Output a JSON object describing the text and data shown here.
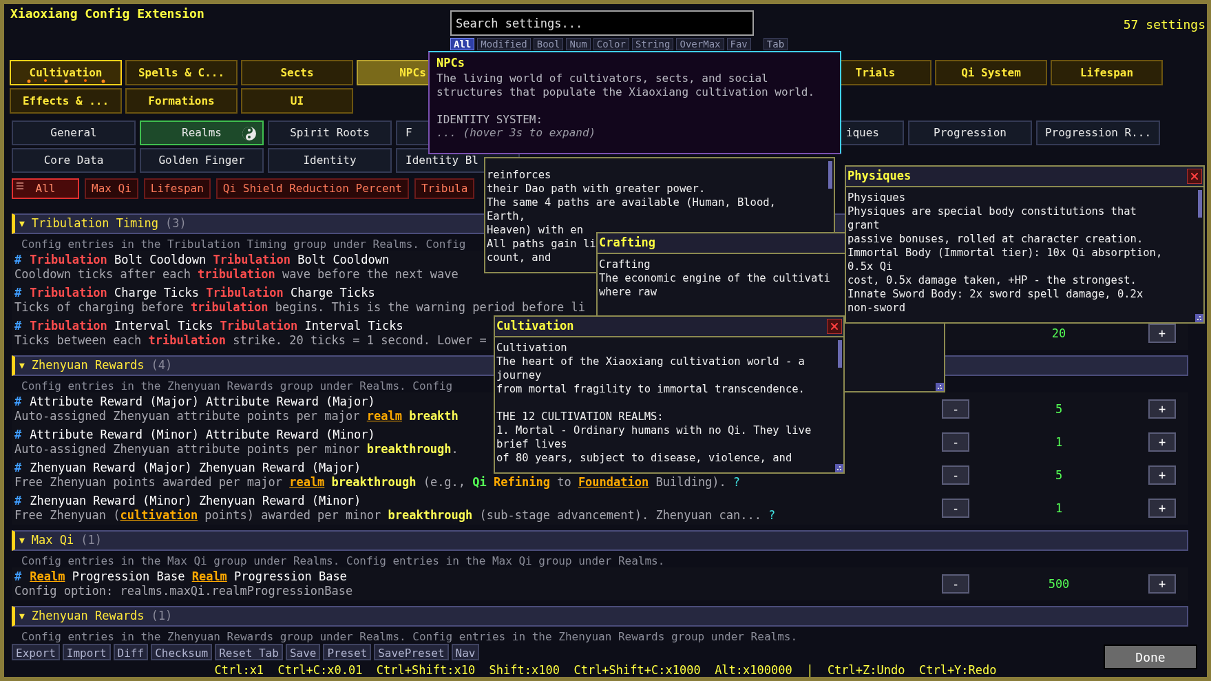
{
  "window": {
    "title": "Xiaoxiang Config Extension",
    "count": "57 settings"
  },
  "search": {
    "placeholder": "Search settings..."
  },
  "type_filters": [
    {
      "label": "All",
      "selected": true
    },
    {
      "label": "Modified",
      "selected": false
    },
    {
      "label": "Bool",
      "selected": false
    },
    {
      "label": "Num",
      "selected": false
    },
    {
      "label": "Color",
      "selected": false
    },
    {
      "label": "String",
      "selected": false
    },
    {
      "label": "OverMax",
      "selected": false
    },
    {
      "label": "Fav",
      "selected": false
    }
  ],
  "tab_chip": "Tab",
  "category_tabs": {
    "row_1_left": [
      {
        "label": "Cultivation",
        "selected": true,
        "hovered": false
      },
      {
        "label": "Spells & C...",
        "selected": false,
        "hovered": false
      },
      {
        "label": "Sects",
        "selected": false,
        "hovered": false
      },
      {
        "label": "NPCs",
        "selected": false,
        "hovered": true
      }
    ],
    "row_1_right": [
      {
        "label": "Trials",
        "selected": false,
        "hovered": false
      },
      {
        "label": "Qi System",
        "selected": false,
        "hovered": false
      },
      {
        "label": "Lifespan",
        "selected": false,
        "hovered": false
      }
    ],
    "row_2": [
      {
        "label": "Effects & ...",
        "selected": false,
        "hovered": false
      },
      {
        "label": "Formations",
        "selected": false,
        "hovered": false
      },
      {
        "label": "UI",
        "selected": false,
        "hovered": false
      }
    ]
  },
  "sub_tabs": {
    "row_1_left": [
      {
        "label": "General",
        "selected": false,
        "kind": "full"
      },
      {
        "label": "Realms",
        "selected": true,
        "kind": "full"
      },
      {
        "label": "Spirit Roots",
        "selected": false,
        "kind": "full"
      },
      {
        "label": "F",
        "selected": false,
        "kind": "cut_right"
      }
    ],
    "row_1_right": [
      {
        "label": "iques",
        "selected": false,
        "kind": "cut_left"
      },
      {
        "label": "Progression",
        "selected": false,
        "kind": "full"
      },
      {
        "label": "Progression R...",
        "selected": false,
        "kind": "full"
      }
    ],
    "row_2": [
      {
        "label": "Core Data",
        "selected": false,
        "kind": "full"
      },
      {
        "label": "Golden Finger",
        "selected": false,
        "kind": "full"
      },
      {
        "label": "Identity",
        "selected": false,
        "kind": "full"
      },
      {
        "label": "Identity Bl",
        "selected": false,
        "kind": "cut_right"
      }
    ]
  },
  "group_filters": [
    {
      "label": "All",
      "selected": true
    },
    {
      "label": "Max Qi",
      "selected": false
    },
    {
      "label": "Lifespan",
      "selected": false
    },
    {
      "label": "Qi Shield Reduction Percent",
      "selected": false
    },
    {
      "label": "Tribula",
      "selected": false
    }
  ],
  "groups": [
    {
      "arrow": "▼",
      "name": "Tribulation Timing",
      "count": "(3)",
      "description": "Config entries in the Tribulation Timing group under Realms. Config",
      "entries": [
        {
          "mark": "#",
          "title": [
            {
              "text": "Tribulation",
              "kind": "danger"
            },
            {
              "text": " Bolt Cooldown ",
              "kind": "plain"
            },
            {
              "text": "Tribulation",
              "kind": "danger"
            },
            {
              "text": " Bolt Cooldown",
              "kind": "plain"
            }
          ],
          "description": [
            {
              "text": "Cooldown ticks after each ",
              "kind": "plain"
            },
            {
              "text": "tribulation",
              "kind": "danger"
            },
            {
              "text": " wave before the next wave",
              "kind": "plain"
            }
          ]
        },
        {
          "mark": "#",
          "title": [
            {
              "text": "Tribulation",
              "kind": "danger"
            },
            {
              "text": " Charge Ticks ",
              "kind": "plain"
            },
            {
              "text": "Tribulation",
              "kind": "danger"
            },
            {
              "text": " Charge Ticks",
              "kind": "plain"
            }
          ],
          "description": [
            {
              "text": "Ticks of charging before ",
              "kind": "plain"
            },
            {
              "text": "tribulation",
              "kind": "danger"
            },
            {
              "text": " begins. This is the warning period before li",
              "kind": "plain"
            }
          ]
        },
        {
          "mark": "#",
          "title": [
            {
              "text": "Tribulation",
              "kind": "danger"
            },
            {
              "text": " Interval Ticks ",
              "kind": "plain"
            },
            {
              "text": "Tribulation",
              "kind": "danger"
            },
            {
              "text": " Interval Ticks",
              "kind": "plain"
            }
          ],
          "description": [
            {
              "text": "Ticks between each ",
              "kind": "plain"
            },
            {
              "text": "tribulation",
              "kind": "danger"
            },
            {
              "text": " strike. 20 ticks = 1 second. Lower =",
              "kind": "plain"
            }
          ],
          "controls": {
            "value": "20",
            "plus": "+"
          }
        }
      ]
    },
    {
      "arrow": "▼",
      "name": "Zhenyuan Rewards",
      "count": "(4)",
      "description": "Config entries in the Zhenyuan Rewards group under Realms. Config",
      "entries": [
        {
          "mark": "#",
          "title": [
            {
              "text": "Attribute Reward (Major) Attribute Reward (Major)",
              "kind": "plain"
            }
          ],
          "description": [
            {
              "text": "Auto-assigned Zhenyuan attribute points per major ",
              "kind": "plain"
            },
            {
              "text": "realm",
              "kind": "term"
            },
            {
              "text": " breakth",
              "kind": "key"
            }
          ],
          "controls": {
            "minus": "-",
            "value": "5",
            "plus": "+"
          }
        },
        {
          "mark": "#",
          "title": [
            {
              "text": "Attribute Reward (Minor) Attribute Reward (Minor)",
              "kind": "plain"
            }
          ],
          "description": [
            {
              "text": "Auto-assigned Zhenyuan attribute points per minor ",
              "kind": "plain"
            },
            {
              "text": "breakthrough",
              "kind": "key"
            },
            {
              "text": ".",
              "kind": "plain"
            }
          ],
          "controls": {
            "minus": "-",
            "value": "1",
            "plus": "+"
          }
        },
        {
          "mark": "#",
          "title": [
            {
              "text": "Zhenyuan Reward (Major) Zhenyuan Reward (Major)",
              "kind": "plain"
            }
          ],
          "description": [
            {
              "text": "Free Zhenyuan points awarded per major ",
              "kind": "plain"
            },
            {
              "text": "realm",
              "kind": "term"
            },
            {
              "text": " breakthrough",
              "kind": "key"
            },
            {
              "text": " (e.g., ",
              "kind": "plain"
            },
            {
              "text": "Qi",
              "kind": "qi"
            },
            {
              "text": " Refining",
              "kind": "refine"
            },
            {
              "text": " to ",
              "kind": "plain"
            },
            {
              "text": "Foundation",
              "kind": "term"
            },
            {
              "text": " Building).",
              "kind": "plain"
            }
          ],
          "help": "?",
          "controls": {
            "minus": "-",
            "value": "5",
            "plus": "+"
          }
        },
        {
          "mark": "#",
          "title": [
            {
              "text": "Zhenyuan Reward (Minor) Zhenyuan Reward (Minor)",
              "kind": "plain"
            }
          ],
          "description": [
            {
              "text": "Free Zhenyuan (",
              "kind": "plain"
            },
            {
              "text": "cultivation",
              "kind": "term"
            },
            {
              "text": " points) awarded per minor ",
              "kind": "plain"
            },
            {
              "text": "breakthrough",
              "kind": "key"
            },
            {
              "text": " (sub-stage advancement). Zhenyuan can...",
              "kind": "plain"
            }
          ],
          "help": "?",
          "controls": {
            "minus": "-",
            "value": "1",
            "plus": "+"
          }
        }
      ]
    },
    {
      "arrow": "▼",
      "name": "Max Qi",
      "count": "(1)",
      "description": "Config entries in the Max Qi group under Realms. Config entries in the Max Qi group under Realms.",
      "entries": [
        {
          "mark": "#",
          "title": [
            {
              "text": "Realm",
              "kind": "term"
            },
            {
              "text": " Progression Base ",
              "kind": "plain"
            },
            {
              "text": "Realm",
              "kind": "term"
            },
            {
              "text": " Progression Base",
              "kind": "plain"
            }
          ],
          "description": [
            {
              "text": "Config option: realms.maxQi.realmProgressionBase",
              "kind": "plain"
            }
          ],
          "controls": {
            "minus": "-",
            "value": "500",
            "plus": "+"
          }
        }
      ]
    },
    {
      "arrow": "▼",
      "name": "Zhenyuan Rewards",
      "count": "(1)",
      "description": "Config entries in the Zhenyuan Rewards group under Realms. Config entries in the Zhenyuan Rewards group under Realms."
    }
  ],
  "footer_buttons": [
    "Export",
    "Import",
    "Diff",
    "Checksum",
    "Reset Tab",
    "Save",
    "Preset",
    "SavePreset",
    "Nav"
  ],
  "done_button": "Done",
  "shortcuts": "Ctrl:x1  Ctrl+C:x0.01  Ctrl+Shift:x10  Shift:x100  Ctrl+Shift+C:x1000  Alt:x100000  |  Ctrl+Z:Undo  Ctrl+Y:Redo",
  "tooltip": {
    "title": "NPCs",
    "paragraphs": [
      [
        "The living world of cultivators, sects, and social",
        "structures that populate the Xiaoxiang cultivation world."
      ],
      [
        "IDENTITY SYSTEM:"
      ]
    ],
    "hint": "... (hover 3s to expand)"
  },
  "popups": [
    {
      "kind": "untitled",
      "paragraphs": [
        [
          "reinforces",
          "their Dao path with greater power.",
          "The same 4 paths are available (Human, Blood,",
          "Earth,",
          "Heaven) with en",
          "All paths gain li",
          "count, and"
        ]
      ]
    },
    {
      "kind": "titled",
      "title": "Crafting",
      "paragraphs": [
        [
          "Crafting",
          "The economic engine of the cultivati",
          "where raw"
        ]
      ]
    },
    {
      "kind": "closable",
      "title": "Physiques",
      "paragraphs": [
        [
          "Physiques",
          "Physiques are special body constitutions that",
          "grant",
          "passive bonuses, rolled at character creation.",
          "Immortal Body (Immortal tier): 10x Qi absorption,",
          "0.5x Qi",
          "cost, 0.5x damage taken, +HP - the strongest.",
          "Innate Sword Body: 2x sword spell damage, 0.2x",
          "non-sword"
        ]
      ]
    },
    {
      "kind": "closable",
      "title": "Cultivation",
      "paragraphs": [
        [
          "Cultivation",
          "The heart of the Xiaoxiang cultivation world - a",
          "journey",
          "from mortal fragility to immortal transcendence."
        ],
        [
          "THE 12 CULTIVATION REALMS:",
          "1. Mortal - Ordinary humans with no Qi. They live",
          "brief lives",
          "of 80 years, subject to disease, violence, and"
        ]
      ]
    }
  ]
}
